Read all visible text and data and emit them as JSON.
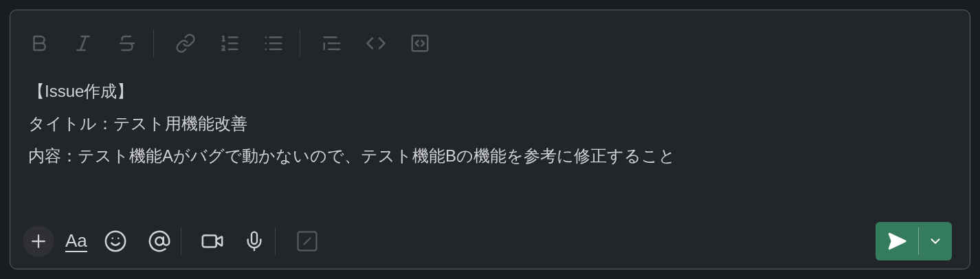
{
  "formatting_toolbar": {
    "disabled": true
  },
  "message": {
    "lines": [
      "【Issue作成】",
      "タイトル：テスト用機能改善",
      "内容：テスト機能Aがバグで動かないので、テスト機能Bの機能を参考に修正すること"
    ]
  },
  "composer_actions": {
    "format_label": "Aa"
  },
  "send_button": {
    "disabled": false
  }
}
